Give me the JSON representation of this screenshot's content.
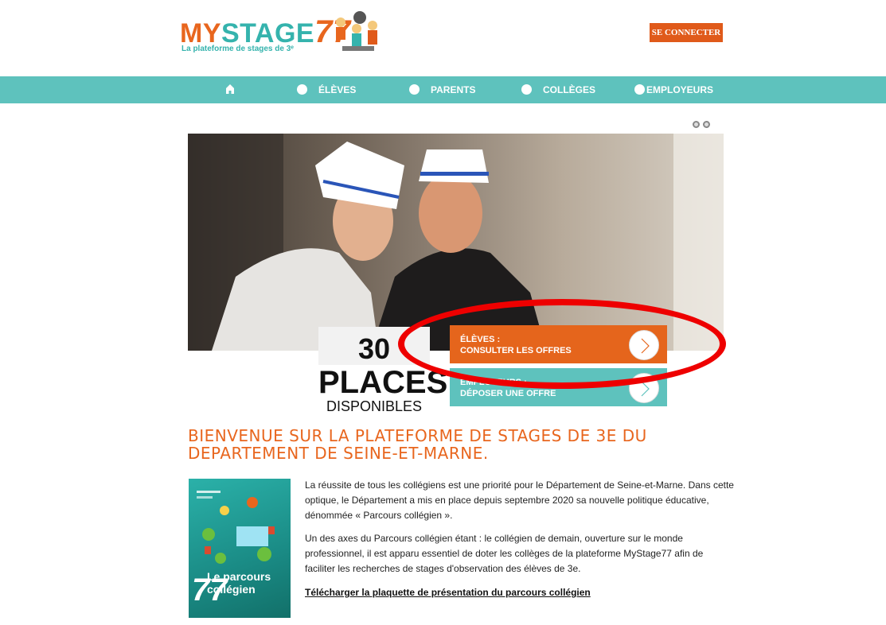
{
  "header": {
    "logo": {
      "my": "MY",
      "stage": "STAGE",
      "num": "77",
      "tagline": "La plateforme de stages de 3ᵉ"
    },
    "connect_label": "SE CONNECTER"
  },
  "nav": {
    "items": [
      {
        "label": "ÉLÈVES"
      },
      {
        "label": "PARENTS"
      },
      {
        "label": "COLLÈGES"
      },
      {
        "label": "EMPLOYEURS"
      }
    ]
  },
  "hero": {
    "places_count": "30",
    "places_label": "PLACES",
    "places_sub": "DISPONIBLES",
    "cta_students": {
      "line1": "ÉLÈVES :",
      "line2": "CONSULTER LES OFFRES"
    },
    "cta_employers": {
      "line1": "EMPLOYEURS :",
      "line2": "DÉPOSER UNE OFFRE"
    }
  },
  "welcome": {
    "title": "BIENVENUE SUR LA PLATEFORME DE STAGES DE 3E DU DEPARTEMENT DE SEINE-ET-MARNE.",
    "brochure": {
      "title_line1": "Le parcours",
      "title_line2": "collégien",
      "number": "77"
    },
    "paragraph1": "La réussite de tous les collégiens est une priorité pour le Département de Seine-et-Marne. Dans cette optique, le Département a mis en place depuis septembre 2020 sa nouvelle politique éducative, dénommée « Parcours collégien ».",
    "paragraph2": "Un des axes du Parcours collégien étant : le collégien de demain, ouverture sur le monde professionnel, il est apparu essentiel de doter les collèges de la plateforme MyStage77 afin de faciliter les recherches de stages d'observation des élèves de 3e.",
    "download_link": "Télécharger la plaquette de présentation du parcours collégien"
  },
  "colors": {
    "orange": "#e5651c",
    "teal": "#5ec2bd",
    "annotation": "#e00000"
  }
}
